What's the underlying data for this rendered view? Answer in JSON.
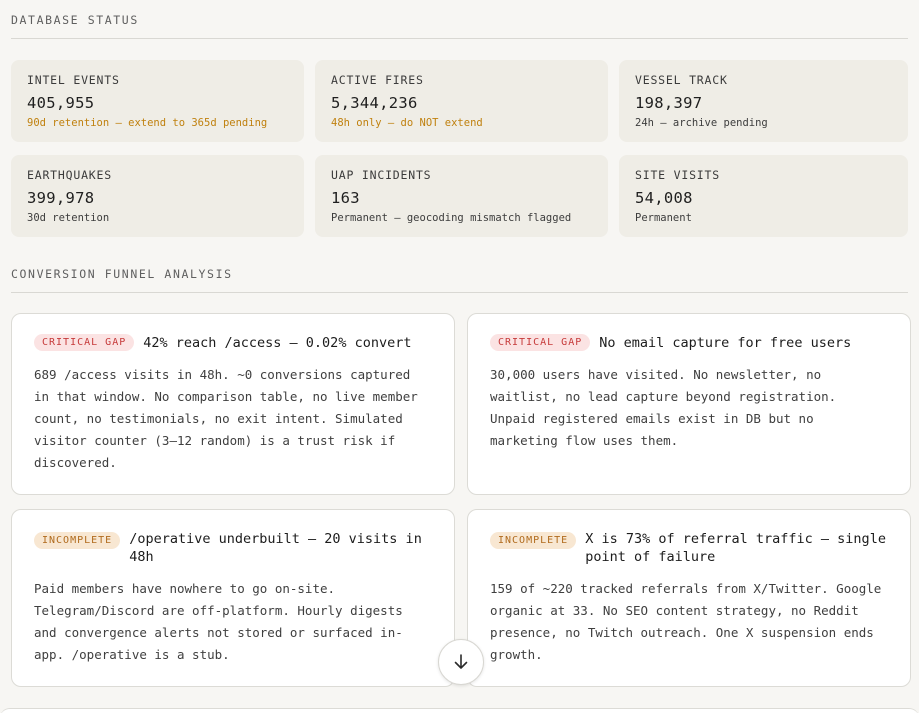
{
  "database_status": {
    "title": "DATABASE STATUS",
    "cards": [
      {
        "label": "INTEL EVENTS",
        "value": "405,955",
        "note": "90d retention — extend to 365d pending",
        "note_color": "#c0810f"
      },
      {
        "label": "ACTIVE FIRES",
        "value": "5,344,236",
        "note": "48h only — do NOT extend",
        "note_color": "#c0810f"
      },
      {
        "label": "VESSEL TRACK",
        "value": "198,397",
        "note": "24h — archive pending",
        "note_color": "#3d3d3d"
      },
      {
        "label": "EARTHQUAKES",
        "value": "399,978",
        "note": "30d retention",
        "note_color": "#3d3d3d"
      },
      {
        "label": "UAP INCIDENTS",
        "value": "163",
        "note": "Permanent — geocoding mismatch flagged",
        "note_color": "#3d3d3d"
      },
      {
        "label": "SITE VISITS",
        "value": "54,008",
        "note": "Permanent",
        "note_color": "#3d3d3d"
      }
    ]
  },
  "funnel": {
    "title": "CONVERSION FUNNEL ANALYSIS",
    "cards": [
      {
        "badge": "CRITICAL GAP",
        "title": "42% reach /access — 0.02% convert",
        "body": "689 /access visits in 48h. ~0 conversions captured in that window. No comparison table, no live member count, no testimonials, no exit intent. Simulated visitor counter (3–12 random) is a trust risk if discovered."
      },
      {
        "badge": "CRITICAL GAP",
        "title": "No email capture for free users",
        "body": "30,000 users have visited. No newsletter, no waitlist, no lead capture beyond registration. Unpaid registered emails exist in DB but no marketing flow uses them."
      },
      {
        "badge": "INCOMPLETE",
        "title": "/operative underbuilt — 20 visits in 48h",
        "body": "Paid members have nowhere to go on-site. Telegram/Discord are off-platform. Hourly digests and convergence alerts not stored or surfaced in-app. /operative is a stub."
      },
      {
        "badge": "INCOMPLETE",
        "title": "X is 73% of referral traffic — single point of failure",
        "body": "159 of ~220 tracked referrals from X/Twitter. Google organic at 33. No SEO content strategy, no Reddit presence, no Twitch outreach. One X suspension ends growth."
      }
    ]
  },
  "scroll_button": {
    "icon": "arrow-down-icon"
  }
}
